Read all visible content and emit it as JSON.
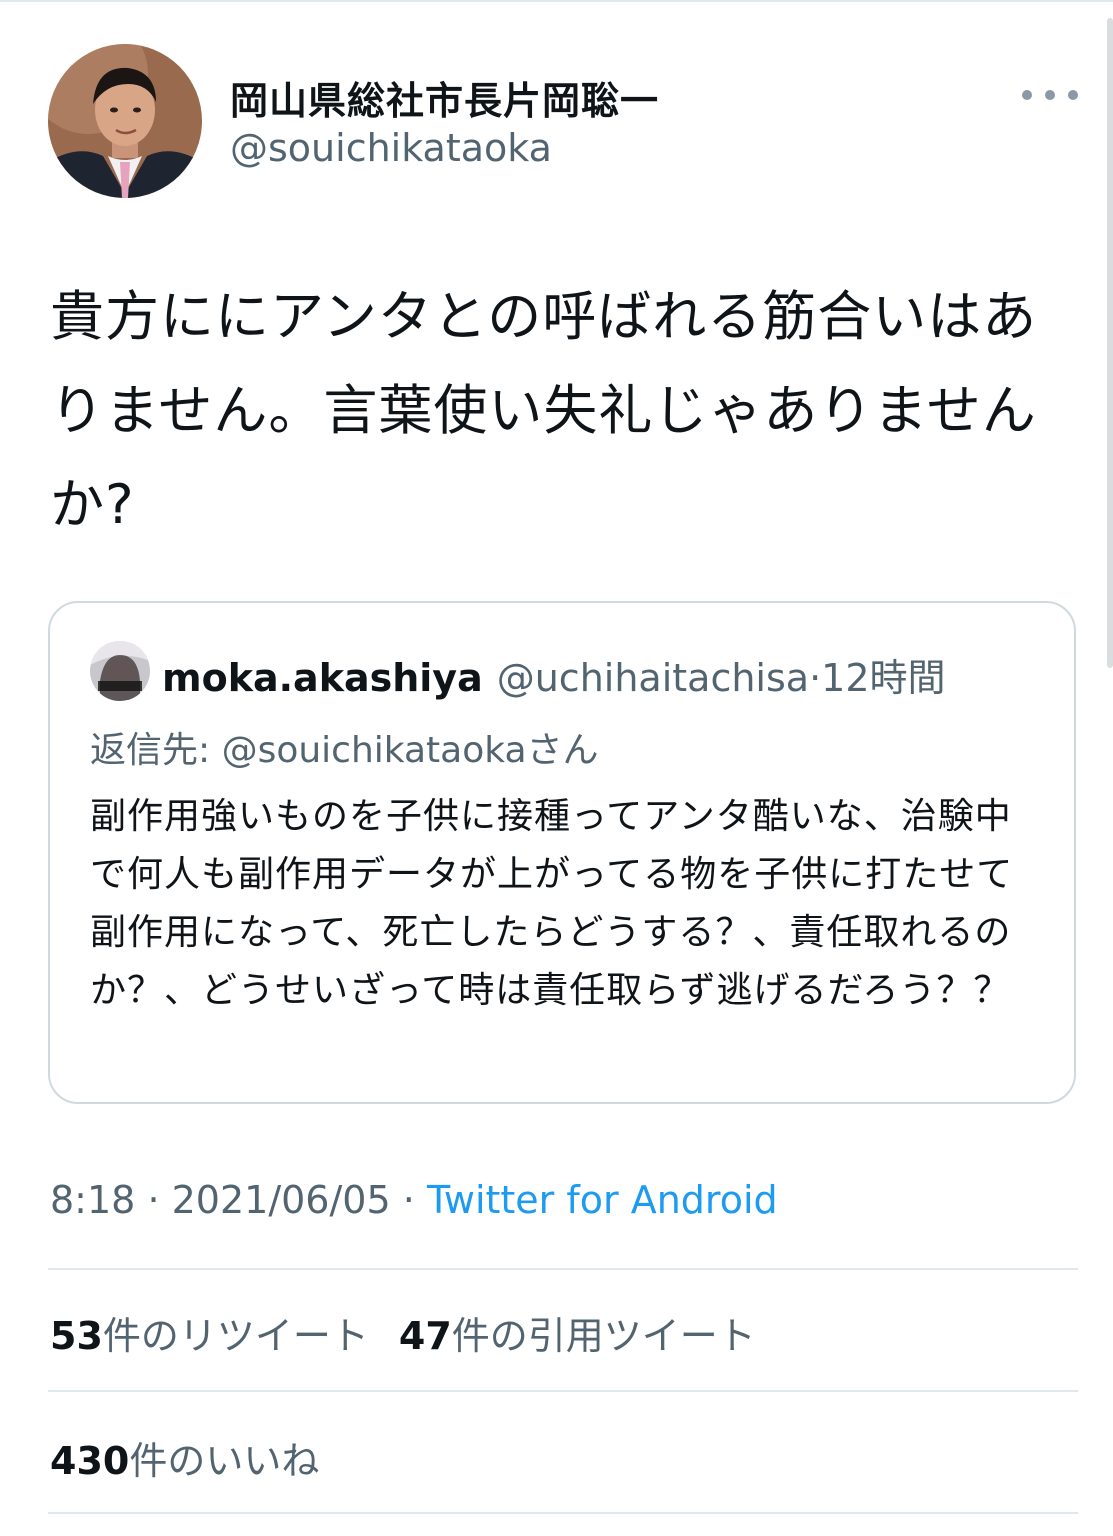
{
  "author": {
    "display_name": "岡山県総社市長片岡聡一",
    "handle": "@souichikataoka"
  },
  "tweet": {
    "text": "貴方ににアンタとの呼ばれる筋合いはありません。言葉使い失礼じゃありませんか?"
  },
  "quoted": {
    "display_name": "moka.akashiya",
    "handle": "@uchihaitachisa",
    "separator": "·",
    "time": "12時間",
    "reply_to": "返信先: @souichikataokaさん",
    "text": "副作用強いものを子供に接種ってアンタ酷いな、治験中で何人も副作用データが上がってる物を子供に打たせて副作用になって、死亡したらどうする？、責任取れるのか？、どうせいざって時は責任取らず逃げるだろう？？"
  },
  "meta": {
    "time": "8:18",
    "sep1": "·",
    "date": "2021/06/05",
    "sep2": "·",
    "source": "Twitter for Android"
  },
  "stats": {
    "retweets_count": "53",
    "retweets_label": "件のリツイート",
    "quotes_count": "47",
    "quotes_label": "件の引用ツイート",
    "likes_count": "430",
    "likes_label": "件のいいね"
  },
  "colors": {
    "link": "#1d9bf0",
    "secondary_text": "#536471",
    "border": "#cfd9de"
  },
  "icons": {
    "more": "more-horizontal-icon"
  }
}
